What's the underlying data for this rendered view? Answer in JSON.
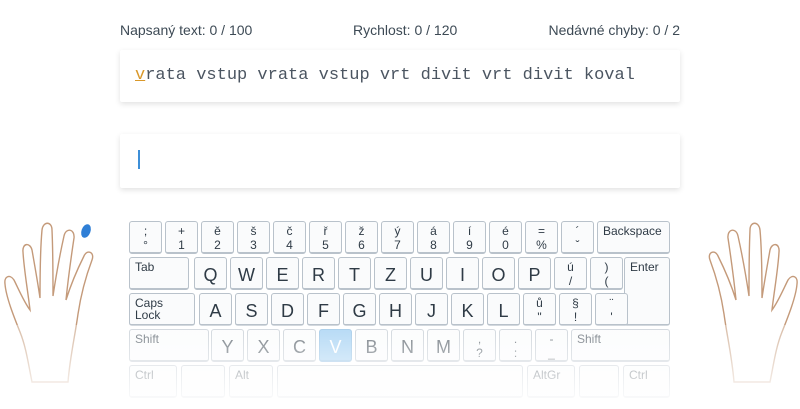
{
  "stats": {
    "typed": "Napsaný text: 0 / 100",
    "speed": "Rychlost: 0 / 120",
    "errors": "Nedávné chyby: 0 / 2"
  },
  "prompt": {
    "current_char": "v",
    "rest": "rata vstup vrata vstup vrt divit vrt divit koval"
  },
  "answer": {
    "value": ""
  },
  "colors": {
    "accent": "#d9982a",
    "caret": "#3d8fd8",
    "highlight_key": "#8cc5f0",
    "finger_marker": "#2f7fd6"
  },
  "keyboard": {
    "row1": [
      {
        "top": ";",
        "bottom": "°"
      },
      {
        "top": "+",
        "bottom": "1"
      },
      {
        "top": "ě",
        "bottom": "2"
      },
      {
        "top": "š",
        "bottom": "3"
      },
      {
        "top": "č",
        "bottom": "4"
      },
      {
        "top": "ř",
        "bottom": "5"
      },
      {
        "top": "ž",
        "bottom": "6"
      },
      {
        "top": "ý",
        "bottom": "7"
      },
      {
        "top": "á",
        "bottom": "8"
      },
      {
        "top": "í",
        "bottom": "9"
      },
      {
        "top": "é",
        "bottom": "0"
      },
      {
        "top": "=",
        "bottom": "%"
      },
      {
        "top": "´",
        "bottom": "ˇ"
      }
    ],
    "backspace": "Backspace",
    "tab": "Tab",
    "row2": [
      "Q",
      "W",
      "E",
      "R",
      "T",
      "Z",
      "U",
      "I",
      "O",
      "P"
    ],
    "row2_sym": [
      {
        "top": "ú",
        "bottom": "/"
      },
      {
        "top": ")",
        "bottom": "("
      }
    ],
    "enter": "Enter",
    "caps": "Caps\nLock",
    "row3": [
      "A",
      "S",
      "D",
      "F",
      "G",
      "H",
      "J",
      "K",
      "L"
    ],
    "row3_sym": [
      {
        "top": "ů",
        "bottom": "\""
      },
      {
        "top": "§",
        "bottom": "!"
      },
      {
        "top": "¨",
        "bottom": "'"
      }
    ],
    "shift_left": "Shift",
    "row4": [
      "Y",
      "X",
      "C",
      "V",
      "B",
      "N",
      "M"
    ],
    "row4_sym": [
      {
        "top": ",",
        "bottom": "?"
      },
      {
        "top": ".",
        "bottom": ":"
      },
      {
        "top": "-",
        "bottom": "_"
      }
    ],
    "shift_right": "Shift",
    "ctrl": "Ctrl",
    "alt": "Alt",
    "altgr": "AltGr",
    "highlight": "V"
  }
}
